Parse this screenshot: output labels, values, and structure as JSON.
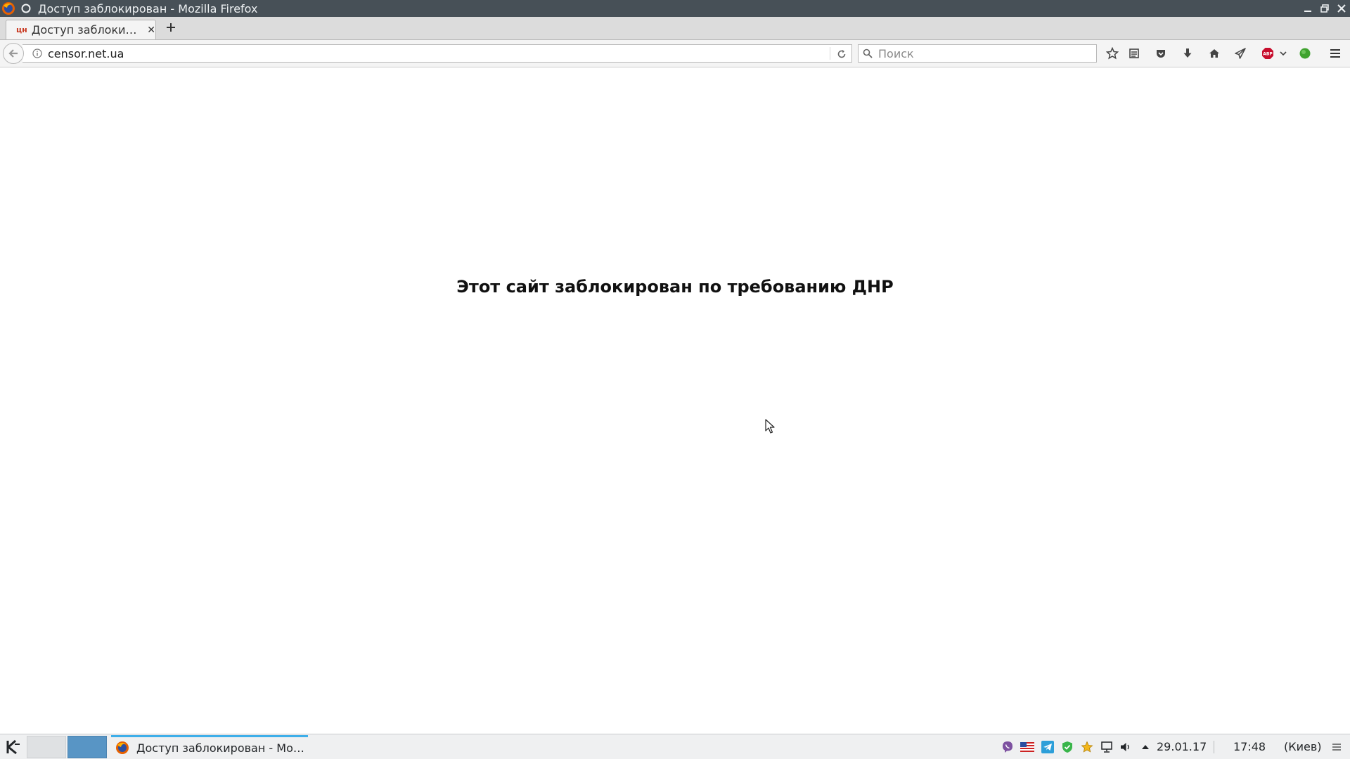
{
  "window": {
    "title": "Доступ заблокирован - Mozilla Firefox",
    "buttons": [
      "minimize-icon",
      "restore-icon",
      "close-icon"
    ]
  },
  "tabs": [
    {
      "favicon_text": "цн",
      "label": "Доступ заблоки…",
      "active": true
    }
  ],
  "navbar": {
    "url": "censor.net.ua",
    "search_placeholder": "Поиск",
    "toolbar_icons": [
      "bookmark-star-icon",
      "reading-list-icon",
      "pocket-icon",
      "download-icon",
      "home-icon",
      "send-icon",
      "adblock-plus-icon",
      "dropdown-chevron-icon",
      "green-status-icon",
      "hamburger-menu-icon"
    ],
    "adblock_badge": "ABP"
  },
  "page": {
    "message": "Этот сайт заблокирован по требованию ДНР"
  },
  "taskbar": {
    "task_label": "Доступ заблокирован - Mo…",
    "tray_icons": [
      "viber-icon",
      "us-flag-icon",
      "telegram-icon",
      "shield-check-icon",
      "star-icon",
      "network-icon",
      "volume-icon",
      "expand-arrow-icon"
    ],
    "date": "29.01.17",
    "time": "17:48",
    "timezone": "(Киев)"
  },
  "colors": {
    "titlebar": "#475057",
    "accent": "#3daee9",
    "pager_active": "#5895c5"
  }
}
